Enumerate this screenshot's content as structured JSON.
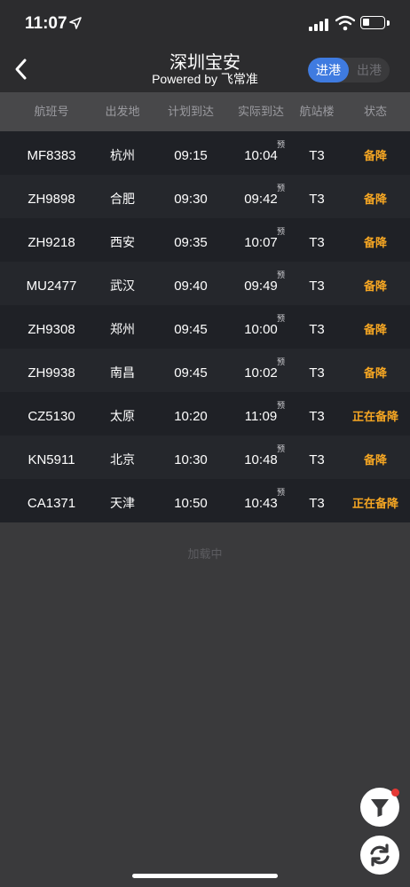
{
  "status_bar": {
    "time": "11:07",
    "location_icon": "location-arrow-icon",
    "signal_icon": "cellular-signal-icon",
    "wifi_icon": "wifi-icon",
    "battery_icon": "battery-icon",
    "battery_level": 0.35
  },
  "header": {
    "back_icon": "chevron-left-icon",
    "title": "深圳宝安",
    "subtitle": "Powered by 飞常准",
    "segment": {
      "arrive_label": "进港",
      "depart_label": "出港",
      "selected": "进港"
    }
  },
  "table": {
    "columns": [
      "航班号",
      "出发地",
      "计划到达",
      "实际到达",
      "航站楼",
      "状态"
    ],
    "pre_mark": "预",
    "rows": [
      {
        "flight": "MF8383",
        "origin": "杭州",
        "scheduled": "09:15",
        "actual": "10:04",
        "terminal": "T3",
        "status": "备降"
      },
      {
        "flight": "ZH9898",
        "origin": "合肥",
        "scheduled": "09:30",
        "actual": "09:42",
        "terminal": "T3",
        "status": "备降"
      },
      {
        "flight": "ZH9218",
        "origin": "西安",
        "scheduled": "09:35",
        "actual": "10:07",
        "terminal": "T3",
        "status": "备降"
      },
      {
        "flight": "MU2477",
        "origin": "武汉",
        "scheduled": "09:40",
        "actual": "09:49",
        "terminal": "T3",
        "status": "备降"
      },
      {
        "flight": "ZH9308",
        "origin": "郑州",
        "scheduled": "09:45",
        "actual": "10:00",
        "terminal": "T3",
        "status": "备降"
      },
      {
        "flight": "ZH9938",
        "origin": "南昌",
        "scheduled": "09:45",
        "actual": "10:02",
        "terminal": "T3",
        "status": "备降"
      },
      {
        "flight": "CZ5130",
        "origin": "太原",
        "scheduled": "10:20",
        "actual": "11:09",
        "terminal": "T3",
        "status": "正在备降"
      },
      {
        "flight": "KN5911",
        "origin": "北京",
        "scheduled": "10:30",
        "actual": "10:48",
        "terminal": "T3",
        "status": "备降"
      },
      {
        "flight": "CA1371",
        "origin": "天津",
        "scheduled": "10:50",
        "actual": "10:43",
        "terminal": "T3",
        "status": "正在备降"
      }
    ]
  },
  "loading_text": "加载中",
  "floating_buttons": {
    "filter_icon": "filter-funnel-icon",
    "refresh_icon": "refresh-icon",
    "notification_dot_color": "#e53935"
  },
  "colors": {
    "accent": "#3f7be0",
    "status": "#f5a623",
    "background": "#3a3a3c"
  }
}
